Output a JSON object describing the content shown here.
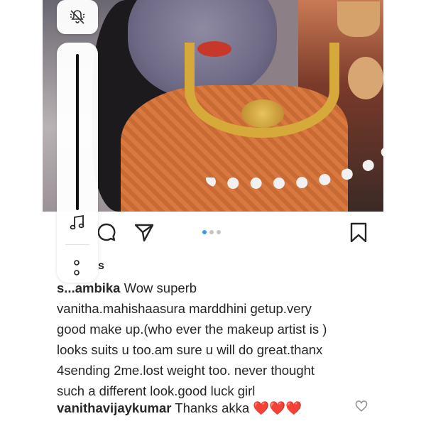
{
  "post": {
    "image_alt": "Woman in Mahishasura Mardini costume with gold jewelry and orange sari",
    "carousel": {
      "dots": 3,
      "active_index": 0
    },
    "actions": [
      "comment-icon",
      "share-icon",
      "save-icon"
    ]
  },
  "likes_fragment": "s",
  "caption": {
    "username": "s...ambika",
    "text_line1": "Wow superb",
    "text_lines": [
      "vanitha.mahishaasura marddhini getup.very",
      "good make up.(who ever the makeup artist is )",
      "looks suits u too.am sure u will do great.thanx",
      "4sending 2me.lost weight too. never thought",
      "such a different look.good luck girl"
    ]
  },
  "reply": {
    "username": "vanithavijaykumar",
    "text": "Thanks akka",
    "emoji": "❤️❤️❤️"
  },
  "overlay": {
    "top_icon": "ringer-silent-icon",
    "slider_icon": "music-note-icon",
    "more_icon": "more-vertical-icon"
  },
  "colors": {
    "text": "#262626",
    "active_dot": "#3897f0",
    "inactive_dot": "#c5c5c5",
    "heart": "#e0245e"
  }
}
